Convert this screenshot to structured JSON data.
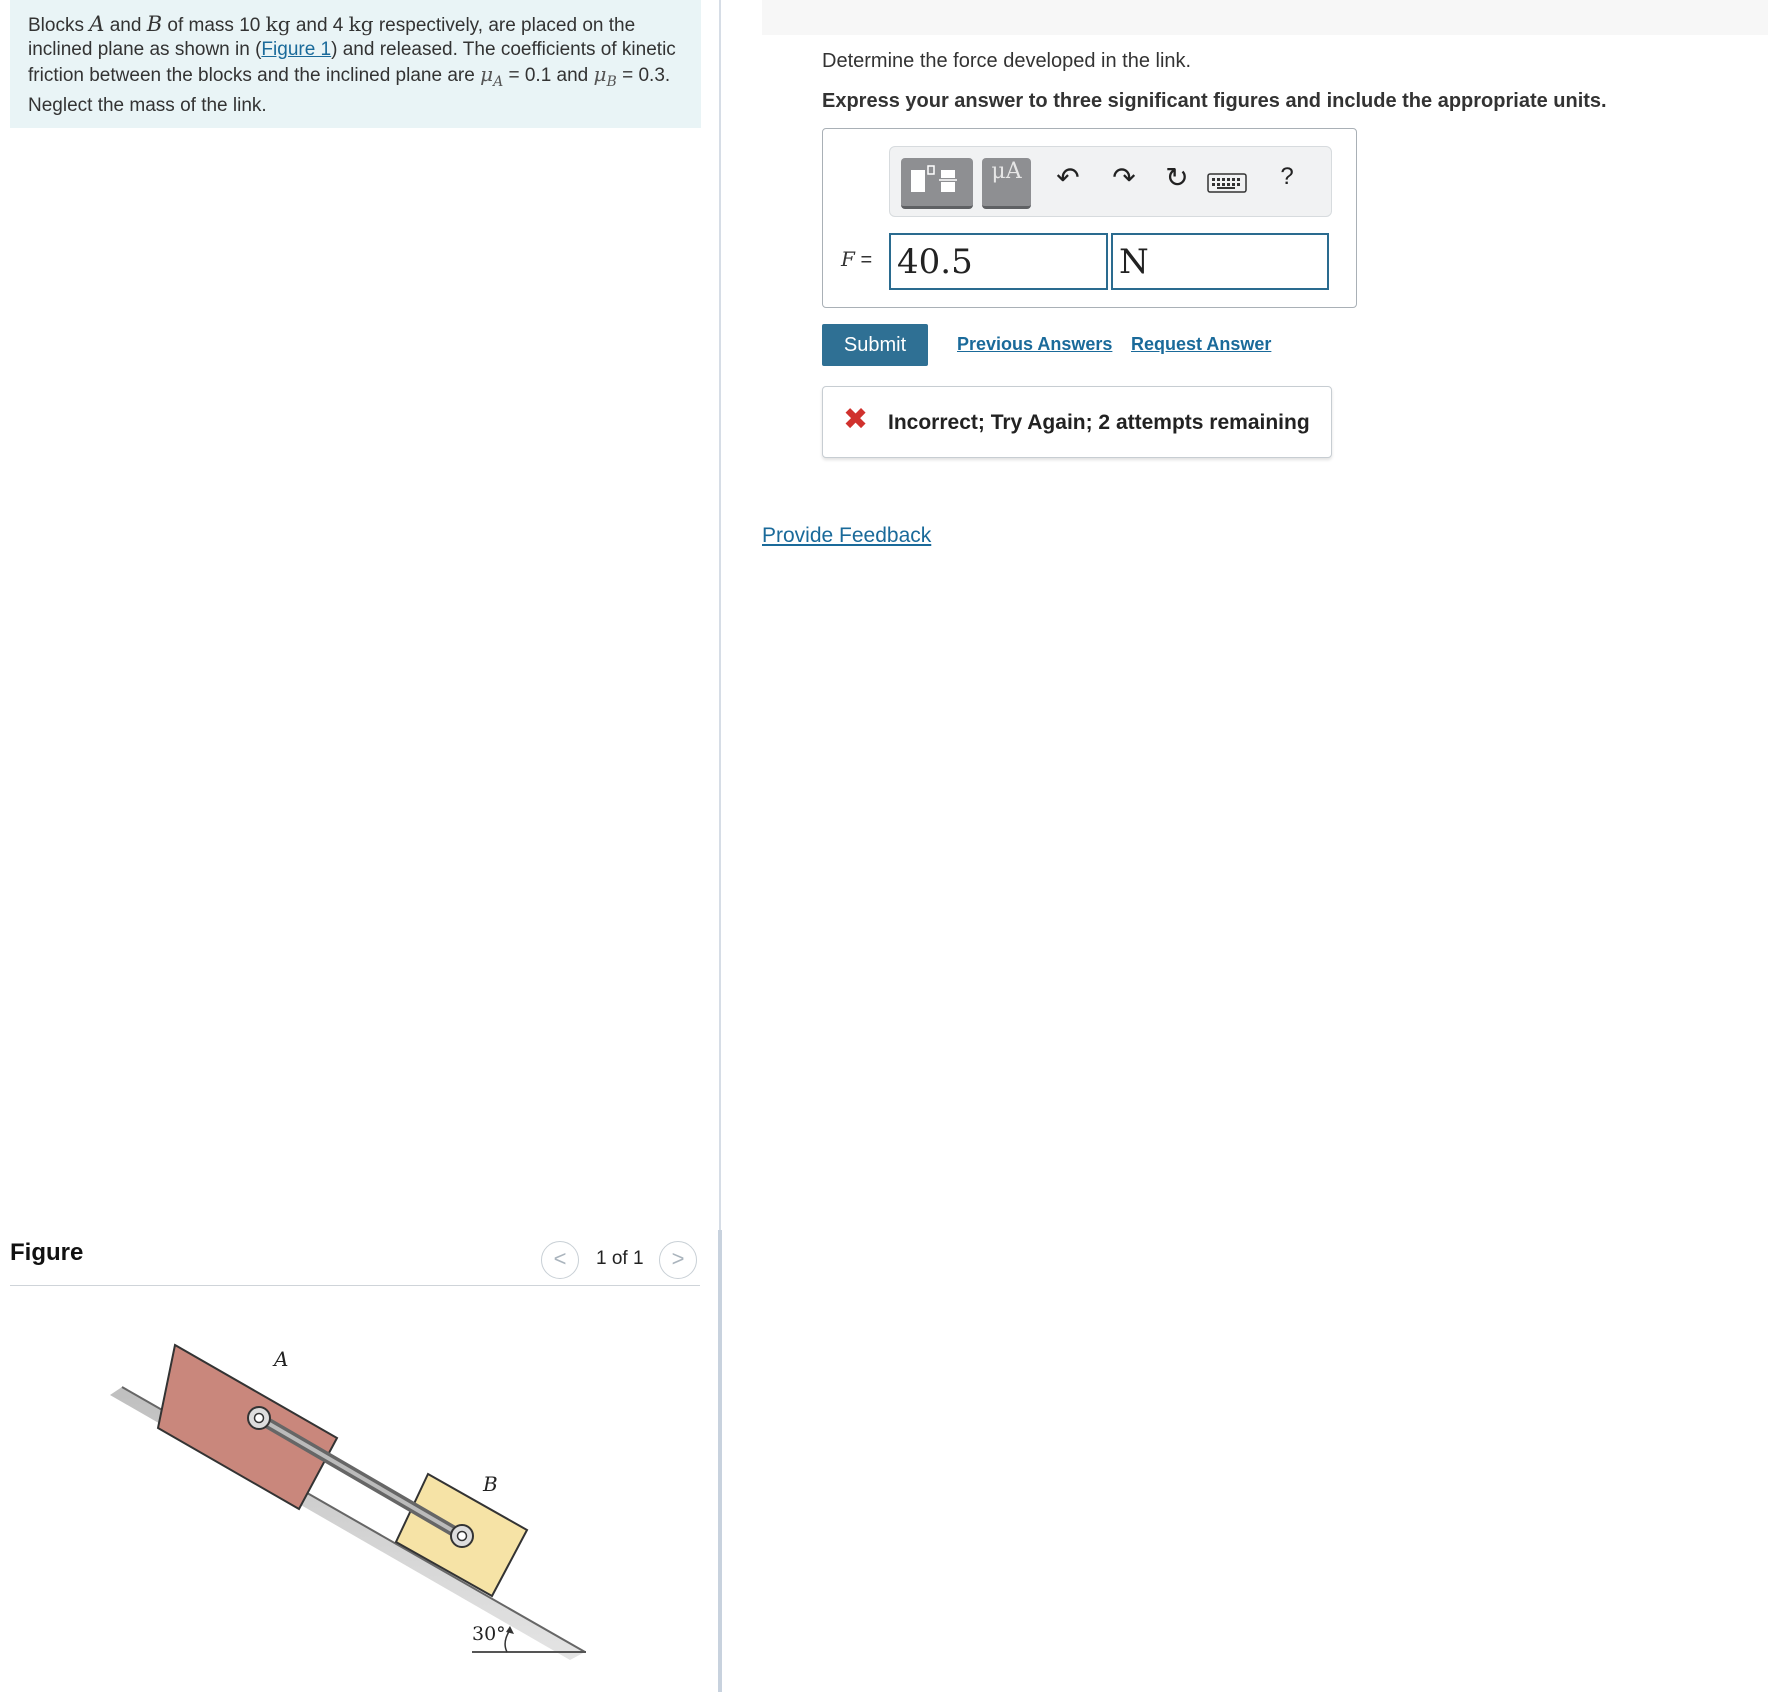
{
  "problem": {
    "t1": "Blocks ",
    "var_a": "A",
    "t2": " and ",
    "var_b": "B",
    "t3": " of mass 10 ",
    "unit_kg_1": "kg",
    "t4": " and 4 ",
    "unit_kg_2": "kg",
    "t5": " respectively, are placed on the inclined plane as shown in (",
    "figure_link": "Figure 1",
    "t6": ") and released. The coefficients of kinetic friction between the blocks and the inclined plane are ",
    "mu": "μ",
    "mu_a_sub": "A",
    "t7": " = 0.1 and ",
    "mu_b_sub": "B",
    "t8": " = 0.3. Neglect the mass of the link."
  },
  "figure": {
    "title": "Figure",
    "page_count": "1 of 1",
    "prev_symbol": "<",
    "next_symbol": ">",
    "label_a": "A",
    "label_b": "B",
    "angle_label": "30°"
  },
  "question": {
    "prompt": "Determine the force developed in the link.",
    "instruction": "Express your answer to three significant figures and include the appropriate units."
  },
  "toolbar": {
    "units_symbol": "μA",
    "undo_symbol": "↶",
    "redo_symbol": "↷",
    "reset_symbol": "↻",
    "keyboard_symbol": "⌨",
    "help_symbol": "?"
  },
  "answer": {
    "variable": "F",
    "equals": " =",
    "value": "40.5",
    "unit": "N"
  },
  "actions": {
    "submit": "Submit",
    "previous_answers": "Previous Answers",
    "request_answer": "Request Answer"
  },
  "feedback": {
    "icon": "✖",
    "message": "Incorrect; Try Again; 2 attempts remaining"
  },
  "footer": {
    "provide_feedback": "Provide Feedback"
  },
  "colors": {
    "accent": "#2f7094",
    "link": "#1a6a9a",
    "error": "#d0312d",
    "problem_bg": "#e9f4f6",
    "block_a": "#c9877c",
    "block_b": "#f6e3a6"
  }
}
